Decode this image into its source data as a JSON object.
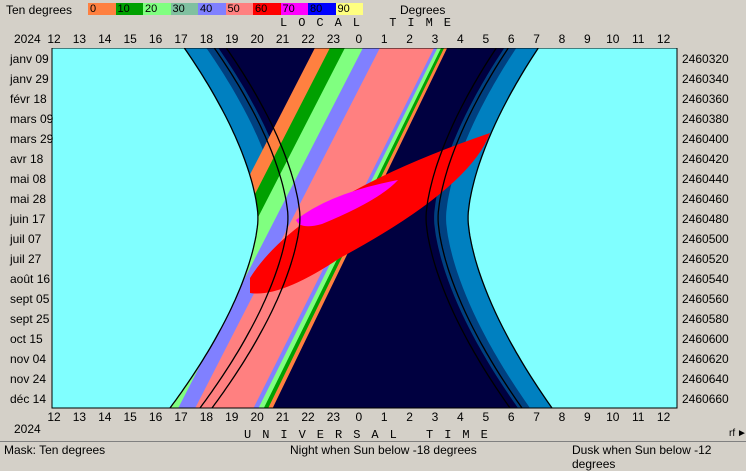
{
  "legend": {
    "title": "Ten degrees",
    "unit": "Degrees",
    "segments": [
      {
        "label": "0",
        "color": "#ff8040"
      },
      {
        "label": "10",
        "color": "#00a000"
      },
      {
        "label": "20",
        "color": "#80ff80"
      },
      {
        "label": "30",
        "color": "#80c0a0"
      },
      {
        "label": "40",
        "color": "#8080ff"
      },
      {
        "label": "50",
        "color": "#ff8080"
      },
      {
        "label": "60",
        "color": "#ff0000"
      },
      {
        "label": "70",
        "color": "#ff00ff"
      },
      {
        "label": "80",
        "color": "#0000ff"
      },
      {
        "label": "90",
        "color": "#ffff80"
      }
    ]
  },
  "top_axis": {
    "year": "2024",
    "title": "LOCAL TIME"
  },
  "bottom_axis": {
    "year": "2024",
    "title": "UNIVERSAL TIME"
  },
  "hour_ticks": [
    "12",
    "13",
    "14",
    "15",
    "16",
    "17",
    "18",
    "19",
    "20",
    "21",
    "22",
    "23",
    "0",
    "1",
    "2",
    "3",
    "4",
    "5",
    "6",
    "7",
    "8",
    "9",
    "10",
    "11",
    "12"
  ],
  "date_labels": [
    "janv 09",
    "janv 29",
    "févr 18",
    "mars 09",
    "mars 29",
    "avr 18",
    "mai 08",
    "mai 28",
    "juin 17",
    "juil 07",
    "juil 27",
    "août 16",
    "sept 05",
    "sept 25",
    "oct 15",
    "nov 04",
    "nov 24",
    "déc 14"
  ],
  "jd_labels": [
    "2460320",
    "2460340",
    "2460360",
    "2460380",
    "2460400",
    "2460420",
    "2460440",
    "2460460",
    "2460480",
    "2460500",
    "2460520",
    "2460540",
    "2460560",
    "2460580",
    "2460600",
    "2460620",
    "2460640",
    "2460660"
  ],
  "colors": {
    "day_sky": "#80ffff",
    "twilight": "#0080c0",
    "dark_twilight": "#004080",
    "night": "#000040",
    "curve": "#000000"
  },
  "status": {
    "mask": "Mask:  Ten degrees",
    "night": "Night when Sun below -18 degrees",
    "dusk": "Dusk when Sun below -12 degrees"
  },
  "corner": "rf"
}
